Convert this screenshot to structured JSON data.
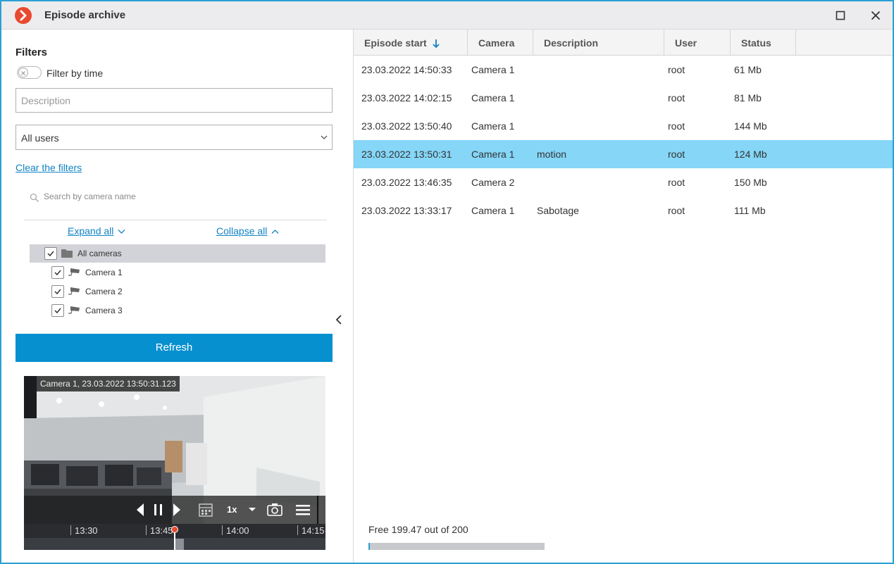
{
  "window": {
    "title": "Episode archive",
    "accent": "#e84a2f",
    "border": "#2aa0d4"
  },
  "filters": {
    "heading": "Filters",
    "filter_by_time_label": "Filter by time",
    "filter_by_time_on": false,
    "description_placeholder": "Description",
    "description_value": "",
    "user_select_value": "All users",
    "clear_link": "Clear the filters",
    "camera_search_placeholder": "Search by camera name",
    "expand_all": "Expand all",
    "collapse_all": "Collapse all",
    "tree": {
      "root": {
        "label": "All cameras",
        "checked": true
      },
      "cameras": [
        {
          "label": "Camera 1",
          "checked": true
        },
        {
          "label": "Camera 2",
          "checked": true
        },
        {
          "label": "Camera 3",
          "checked": true
        }
      ]
    },
    "refresh_button": "Refresh",
    "refresh_color": "#0790cf"
  },
  "player": {
    "caption": "Camera 1, 23.03.2022 13:50:31.123",
    "speed": "1x",
    "timeline_ticks": [
      "13:30",
      "13:45",
      "14:00",
      "14:15"
    ]
  },
  "table": {
    "columns": [
      "Episode start",
      "Camera",
      "Description",
      "User",
      "Status"
    ],
    "sort_column": "Episode start",
    "sort_direction": "descending",
    "rows": [
      {
        "start": "23.03.2022 14:50:33",
        "camera": "Camera 1",
        "description": "",
        "user": "root",
        "status": "61 Mb",
        "selected": false
      },
      {
        "start": "23.03.2022 14:02:15",
        "camera": "Camera 1",
        "description": "",
        "user": "root",
        "status": "81 Mb",
        "selected": false
      },
      {
        "start": "23.03.2022 13:50:40",
        "camera": "Camera 1",
        "description": "",
        "user": "root",
        "status": "144 Mb",
        "selected": false
      },
      {
        "start": "23.03.2022 13:50:31",
        "camera": "Camera 1",
        "description": "motion",
        "user": "root",
        "status": "124 Mb",
        "selected": true
      },
      {
        "start": "23.03.2022 13:46:35",
        "camera": "Camera 2",
        "description": "",
        "user": "root",
        "status": "150 Mb",
        "selected": false
      },
      {
        "start": "23.03.2022 13:33:17",
        "camera": "Camera 1",
        "description": "Sabotage",
        "user": "root",
        "status": "111 Mb",
        "selected": false
      }
    ],
    "selected_color": "#85d6f7"
  },
  "storage": {
    "label": "Free 199.47 out of 200",
    "used_fraction": 0.0027
  }
}
